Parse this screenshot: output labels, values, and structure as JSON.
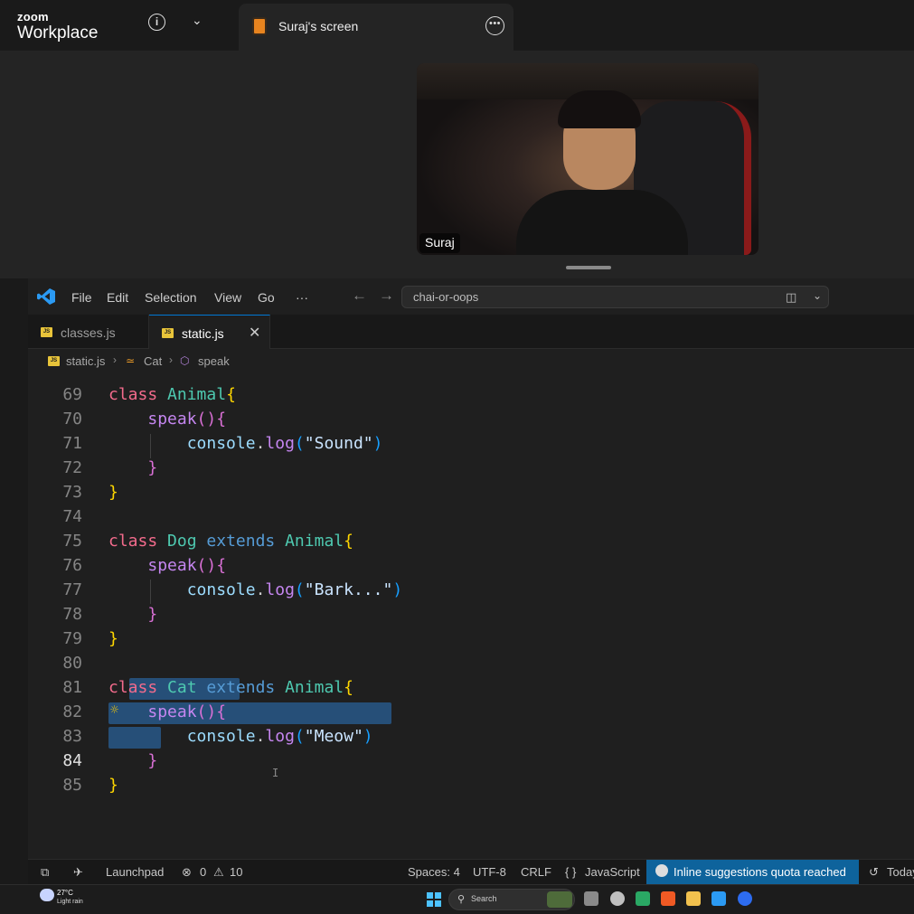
{
  "zoom": {
    "logo_small": "zoom",
    "logo_big": "Workplace",
    "share_title": "Suraj's screen",
    "participant_name": "Suraj"
  },
  "titlebar": {
    "menus": [
      "File",
      "Edit",
      "Selection",
      "View",
      "Go",
      "···"
    ],
    "search_text": "chai-or-oops"
  },
  "tabs": [
    {
      "label": "classes.js",
      "icon": "JS",
      "active": false
    },
    {
      "label": "static.js",
      "icon": "JS",
      "active": true
    }
  ],
  "breadcrumb": {
    "file": "static.js",
    "class": "Cat",
    "method": "speak"
  },
  "editor": {
    "line_numbers": [
      "69",
      "70",
      "71",
      "72",
      "73",
      "74",
      "75",
      "76",
      "77",
      "78",
      "79",
      "80",
      "81",
      "82",
      "83",
      "84",
      "85"
    ],
    "current_line": "84",
    "code": {
      "class_kw": "class",
      "extends_kw": "extends",
      "animal": "Animal",
      "dog": "Dog",
      "cat": "Cat",
      "speak": "speak",
      "console": "console",
      "log": "log",
      "sound": "\"Sound\"",
      "bark": "\"Bark...\"",
      "meow": "\"Meow\""
    }
  },
  "statusbar": {
    "launchpad": "Launchpad",
    "errors": "0",
    "warnings": "10",
    "spaces": "Spaces: 4",
    "encoding": "UTF-8",
    "eol": "CRLF",
    "language": "JavaScript",
    "notice": "Inline suggestions quota reached",
    "today": "Today"
  },
  "taskbar": {
    "temperature": "27°C",
    "weather": "Light rain",
    "search_placeholder": "Search"
  }
}
